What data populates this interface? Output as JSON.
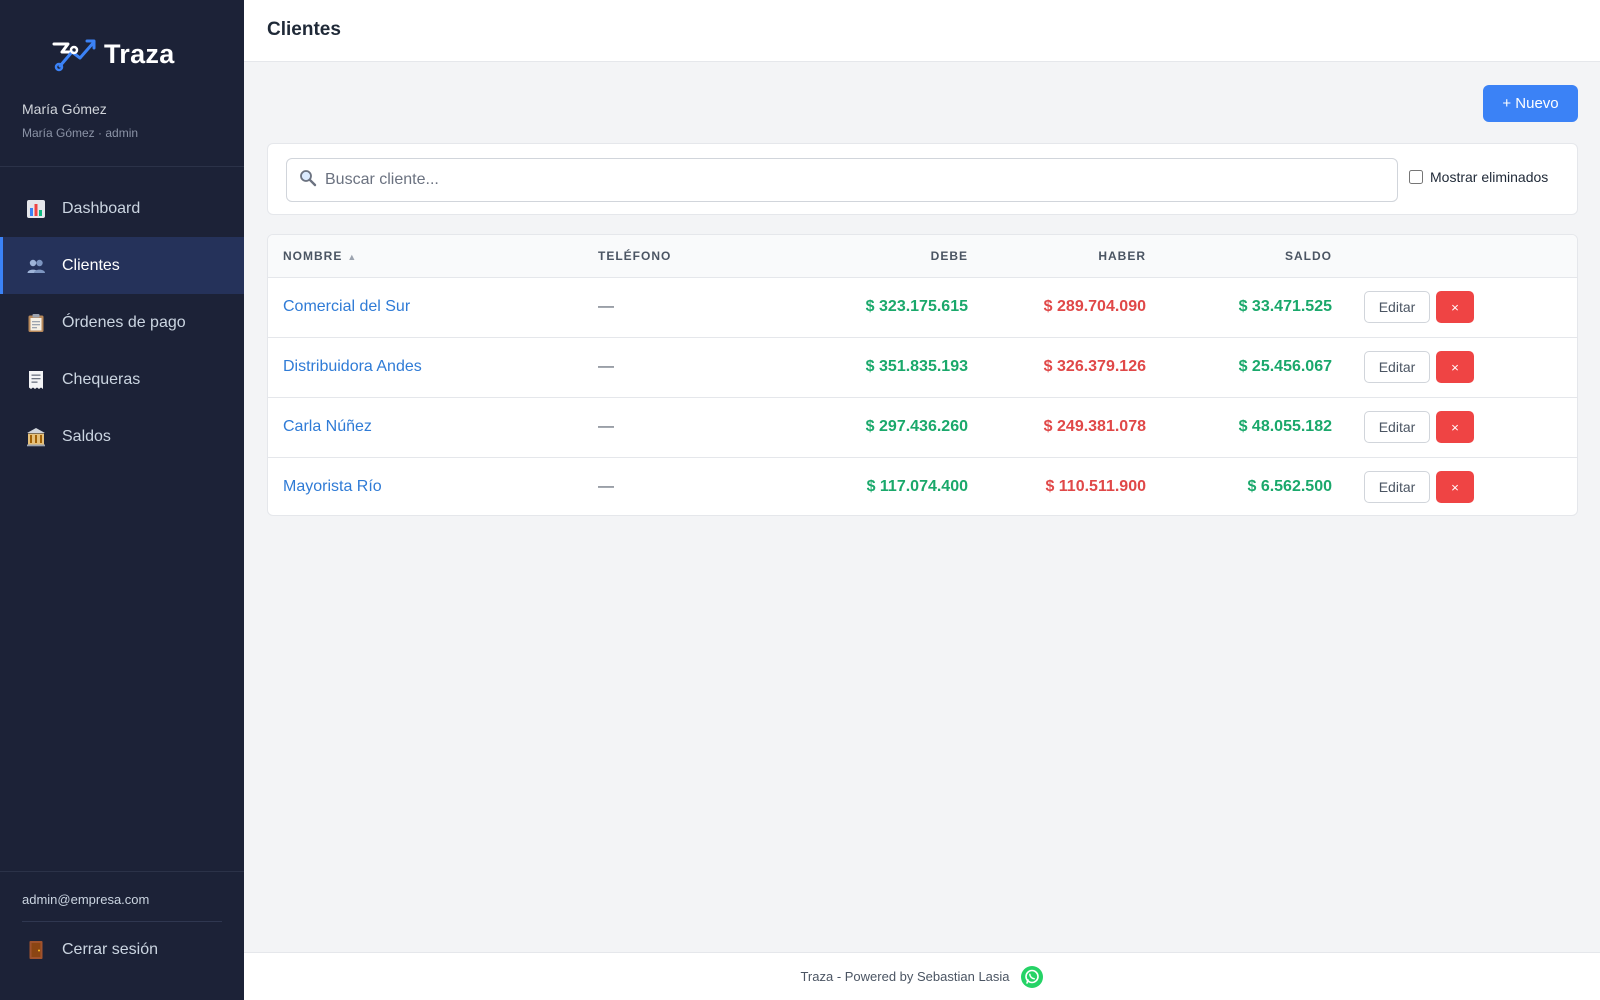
{
  "app": {
    "name": "Traza"
  },
  "sidebar": {
    "user_name": "María Gómez",
    "user_role": "María Gómez · admin",
    "items": [
      {
        "label": "Dashboard",
        "icon": "bar-chart-icon"
      },
      {
        "label": "Clientes",
        "icon": "users-icon",
        "active": true
      },
      {
        "label": "Órdenes de pago",
        "icon": "clipboard-icon"
      },
      {
        "label": "Chequeras",
        "icon": "receipt-icon"
      },
      {
        "label": "Saldos",
        "icon": "bank-icon"
      }
    ],
    "email": "admin@empresa.com",
    "logout_label": "Cerrar sesión"
  },
  "header": {
    "title": "Clientes"
  },
  "toolbar": {
    "new_label": "+ Nuevo"
  },
  "search": {
    "placeholder": "Buscar cliente...",
    "value": ""
  },
  "filters": {
    "show_deleted_label": "Mostrar eliminados",
    "show_deleted": false
  },
  "table": {
    "columns": {
      "nombre": "NOMBRE",
      "telefono": "TELÉFONO",
      "debe": "DEBE",
      "haber": "HABER",
      "saldo": "SALDO"
    },
    "sort_indicator": "▲",
    "edit_label": "Editar",
    "delete_symbol": "×",
    "rows": [
      {
        "nombre": "Comercial del Sur",
        "telefono": "—",
        "debe": "$ 323.175.615",
        "haber": "$ 289.704.090",
        "saldo": "$ 33.471.525"
      },
      {
        "nombre": "Distribuidora Andes",
        "telefono": "—",
        "debe": "$ 351.835.193",
        "haber": "$ 326.379.126",
        "saldo": "$ 25.456.067"
      },
      {
        "nombre": "Carla Núñez",
        "telefono": "—",
        "debe": "$ 297.436.260",
        "haber": "$ 249.381.078",
        "saldo": "$ 48.055.182"
      },
      {
        "nombre": "Mayorista Río",
        "telefono": "—",
        "debe": "$ 117.074.400",
        "haber": "$ 110.511.900",
        "saldo": "$ 6.562.500"
      }
    ]
  },
  "footer": {
    "text": "Traza - Powered by Sebastian Lasia"
  },
  "colors": {
    "sidebar_bg": "#1c2237",
    "accent": "#3b82f6",
    "positive": "#1aa86b",
    "negative": "#e04848",
    "link": "#2f7bd6"
  }
}
